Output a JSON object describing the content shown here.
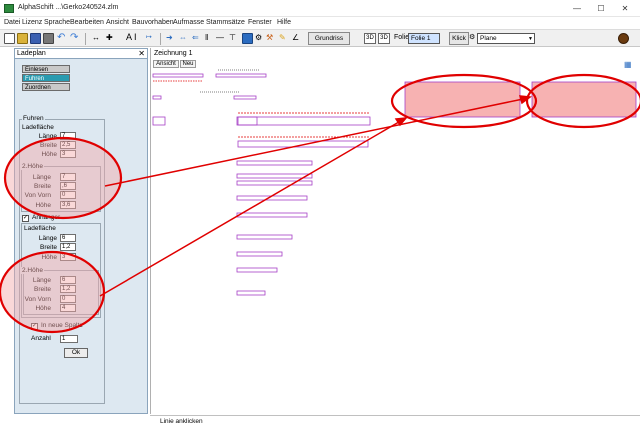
{
  "window": {
    "title": "AlphaSchift ...\\Gerko240524.zlm",
    "minimize": "—",
    "maximize": "☐",
    "close": "✕"
  },
  "menu": [
    "Datei",
    "Lizenz",
    "Sprache",
    "Bearbeiten",
    "Ansicht",
    "Bauvorhaben",
    "Aufmasse",
    "Stammsätze",
    "Fenster",
    "Hilfe"
  ],
  "toolbar": {
    "text_tool": "A I",
    "grundriss": "Grundriss",
    "scale_a": "3D",
    "scale_b": "3D",
    "folie_label": "Folie",
    "folie_value": "Folie 1",
    "klick_label": "Klick",
    "plane_value": "Plane"
  },
  "side_panel": {
    "title": "Ladeplan",
    "close": "✕",
    "modes": [
      {
        "label": "Einlesen",
        "active": false
      },
      {
        "label": "Fuhren",
        "active": true
      },
      {
        "label": "Zuordnen",
        "active": false
      }
    ],
    "fuhren_label": "Fuhren",
    "ladeflaeche1_label": "Ladefläche",
    "ladeflaeche1": [
      {
        "label": "Länge",
        "value": "7"
      },
      {
        "label": "Breite",
        "value": "2,5"
      },
      {
        "label": "Höhe",
        "value": "3"
      }
    ],
    "hoehe2_label": "2.Höhe",
    "hoehe2": [
      {
        "label": "Länge",
        "value": "7"
      },
      {
        "label": "Breite",
        "value": ",6"
      },
      {
        "label": "Von Vorn",
        "value": "0"
      },
      {
        "label": "Höhe",
        "value": "3,6"
      }
    ],
    "anhaenger_label": "Anhänger",
    "ladeflaeche2_label": "Ladefläche",
    "ladeflaeche2": [
      {
        "label": "Länge",
        "value": "6"
      },
      {
        "label": "Breite",
        "value": "1,2"
      },
      {
        "label": "Höhe",
        "value": "3"
      }
    ],
    "hoehe2b_label": "2.Höhe",
    "hoehe2b": [
      {
        "label": "Länge",
        "value": "6"
      },
      {
        "label": "Breite",
        "value": "1,2"
      },
      {
        "label": "Von Vorn",
        "value": "0"
      },
      {
        "label": "Höhe",
        "value": "4"
      }
    ],
    "neue_spalte_label": "In neue Spalte",
    "anzahl_label": "Anzahl",
    "anzahl_value": "1",
    "ok_label": "Ok"
  },
  "drawing": {
    "tab_label": "Zeichnung 1",
    "subtabs": [
      "Ansicht",
      "Neu"
    ]
  },
  "status": {
    "text": "Linie anklicken"
  },
  "colors": {
    "highlight_red": "#e00000",
    "highlight_fill": "#f7b2b2",
    "drawing_purple": "#a63fc6",
    "active_mode": "#2a9bb0",
    "panel_bg": "#dde8f1"
  }
}
